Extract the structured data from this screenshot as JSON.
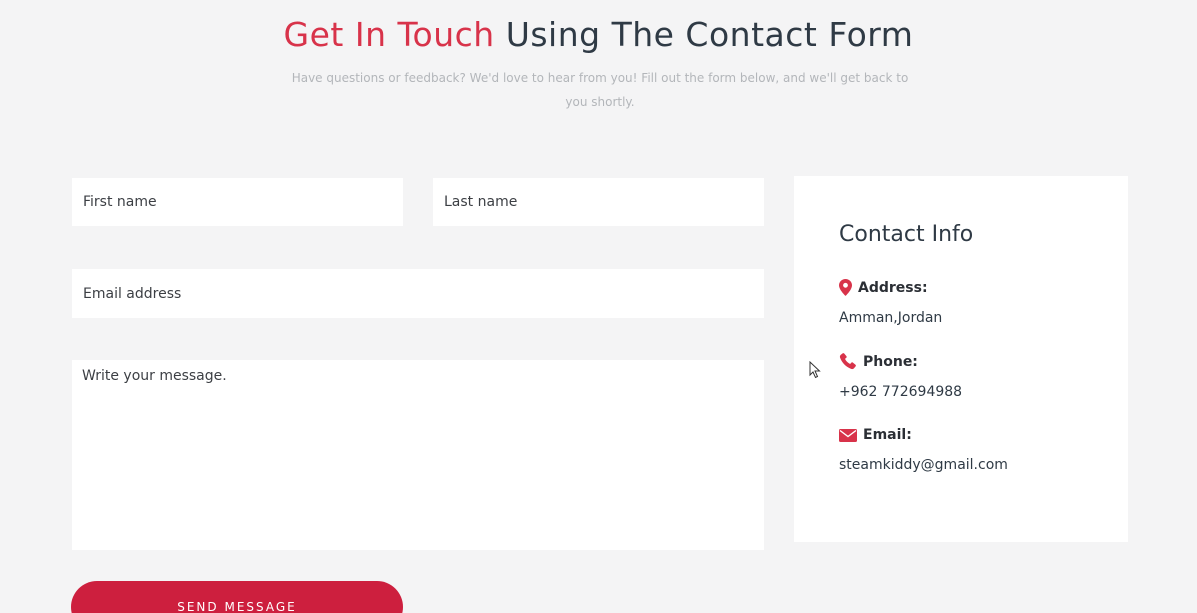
{
  "header": {
    "title_accent": "Get In Touch",
    "title_rest": "Using The Contact Form",
    "subtitle": "Have questions or feedback? We'd love to hear from you! Fill out the form below, and we'll get back to you shortly."
  },
  "form": {
    "first_name_placeholder": "First name",
    "last_name_placeholder": "Last name",
    "email_placeholder": "Email address",
    "message_placeholder": "Write your message.",
    "submit_label": "SEND MESSAGE"
  },
  "contact_info": {
    "title": "Contact Info",
    "address_label": "Address:",
    "address_value": "Amman,Jordan",
    "phone_label": "Phone:",
    "phone_value": "+962 772694988",
    "email_label": "Email:",
    "email_value": "steamkiddy@gmail.com"
  },
  "icons": {
    "address": "map-pin-icon",
    "phone": "phone-icon",
    "email": "envelope-icon"
  },
  "colors": {
    "accent": "#d8334a",
    "button": "#cd1f3e",
    "text_dark": "#2f3a45",
    "subtitle": "#b3b6ba",
    "background": "#f4f4f5"
  }
}
